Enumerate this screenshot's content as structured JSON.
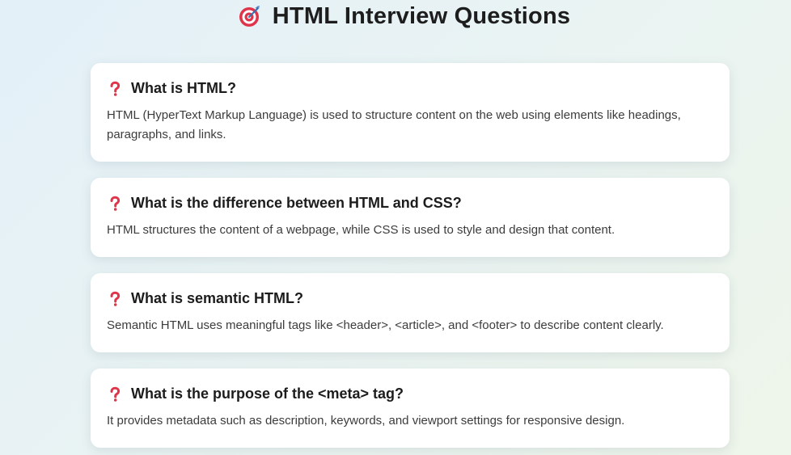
{
  "page": {
    "title": "HTML Interview Questions",
    "title_icon": "bullseye-dart-icon"
  },
  "questions": [
    {
      "question": "What is HTML?",
      "answer": "HTML (HyperText Markup Language) is used to structure content on the web using elements like headings, paragraphs, and links."
    },
    {
      "question": "What is the difference between HTML and CSS?",
      "answer": "HTML structures the content of a webpage, while CSS is used to style and design that content."
    },
    {
      "question": "What is semantic HTML?",
      "answer": "Semantic HTML uses meaningful tags like <header>, <article>, and <footer> to describe content clearly."
    },
    {
      "question": "What is the purpose of the <meta> tag?",
      "answer": "It provides metadata such as description, keywords, and viewport settings for responsive design."
    }
  ],
  "icons": {
    "question": "red-question-mark-icon"
  },
  "colors": {
    "accent_red": "#e0344a",
    "card_bg": "#ffffff",
    "heading_text": "#1d1d1d",
    "body_text": "#3c3c3c"
  }
}
